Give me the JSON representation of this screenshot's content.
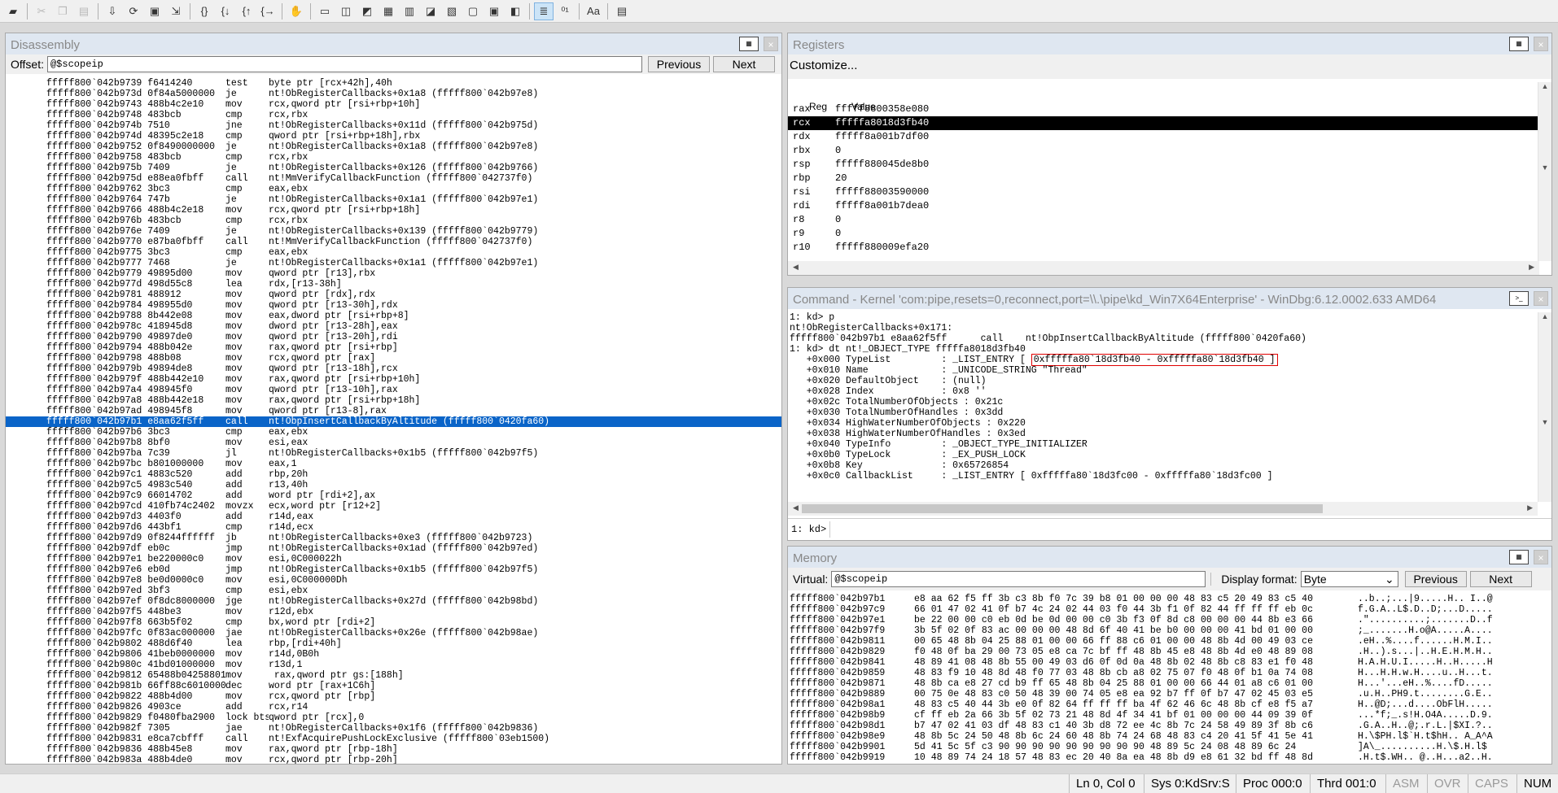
{
  "toolbar": {
    "icons": [
      "open-icon",
      "cut-icon",
      "copy-icon",
      "paste-icon",
      "step-into-icon",
      "step-over-icon",
      "step-out-icon",
      "run-to-cursor-icon",
      "go-icon",
      "break-icon",
      "restart-icon",
      "stop-icon",
      "source-mode-icon",
      "command-icon",
      "watch-icon",
      "locals-icon",
      "registers-icon",
      "memory-icon",
      "call-stack-icon",
      "disassembly-icon",
      "scratch-pad-icon",
      "processes-icon",
      "source-mode-toggle-icon",
      "hex-mode-icon",
      "font-icon",
      "options-icon"
    ]
  },
  "disassembly": {
    "title": "Disassembly",
    "offset_label": "Offset:",
    "offset_value": "@$scopeip",
    "previous_label": "Previous",
    "next_label": "Next",
    "lines": [
      {
        "addr": "fffff800`042b9739 f6414240",
        "mn": "test",
        "op": "byte ptr [rcx+42h],40h"
      },
      {
        "addr": "fffff800`042b973d 0f84a5000000",
        "mn": "je",
        "op": "nt!ObRegisterCallbacks+0x1a8 (fffff800`042b97e8)"
      },
      {
        "addr": "fffff800`042b9743 488b4c2e10",
        "mn": "mov",
        "op": "rcx,qword ptr [rsi+rbp+10h]"
      },
      {
        "addr": "fffff800`042b9748 483bcb",
        "mn": "cmp",
        "op": "rcx,rbx"
      },
      {
        "addr": "fffff800`042b974b 7510",
        "mn": "jne",
        "op": "nt!ObRegisterCallbacks+0x11d (fffff800`042b975d)"
      },
      {
        "addr": "fffff800`042b974d 48395c2e18",
        "mn": "cmp",
        "op": "qword ptr [rsi+rbp+18h],rbx"
      },
      {
        "addr": "fffff800`042b9752 0f8490000000",
        "mn": "je",
        "op": "nt!ObRegisterCallbacks+0x1a8 (fffff800`042b97e8)"
      },
      {
        "addr": "fffff800`042b9758 483bcb",
        "mn": "cmp",
        "op": "rcx,rbx"
      },
      {
        "addr": "fffff800`042b975b 7409",
        "mn": "je",
        "op": "nt!ObRegisterCallbacks+0x126 (fffff800`042b9766)"
      },
      {
        "addr": "fffff800`042b975d e88ea0fbff",
        "mn": "call",
        "op": "nt!MmVerifyCallbackFunction (fffff800`042737f0)"
      },
      {
        "addr": "fffff800`042b9762 3bc3",
        "mn": "cmp",
        "op": "eax,ebx"
      },
      {
        "addr": "fffff800`042b9764 747b",
        "mn": "je",
        "op": "nt!ObRegisterCallbacks+0x1a1 (fffff800`042b97e1)"
      },
      {
        "addr": "fffff800`042b9766 488b4c2e18",
        "mn": "mov",
        "op": "rcx,qword ptr [rsi+rbp+18h]"
      },
      {
        "addr": "fffff800`042b976b 483bcb",
        "mn": "cmp",
        "op": "rcx,rbx"
      },
      {
        "addr": "fffff800`042b976e 7409",
        "mn": "je",
        "op": "nt!ObRegisterCallbacks+0x139 (fffff800`042b9779)"
      },
      {
        "addr": "fffff800`042b9770 e87ba0fbff",
        "mn": "call",
        "op": "nt!MmVerifyCallbackFunction (fffff800`042737f0)"
      },
      {
        "addr": "fffff800`042b9775 3bc3",
        "mn": "cmp",
        "op": "eax,ebx"
      },
      {
        "addr": "fffff800`042b9777 7468",
        "mn": "je",
        "op": "nt!ObRegisterCallbacks+0x1a1 (fffff800`042b97e1)"
      },
      {
        "addr": "fffff800`042b9779 49895d00",
        "mn": "mov",
        "op": "qword ptr [r13],rbx"
      },
      {
        "addr": "fffff800`042b977d 498d55c8",
        "mn": "lea",
        "op": "rdx,[r13-38h]"
      },
      {
        "addr": "fffff800`042b9781 488912",
        "mn": "mov",
        "op": "qword ptr [rdx],rdx"
      },
      {
        "addr": "fffff800`042b9784 498955d0",
        "mn": "mov",
        "op": "qword ptr [r13-30h],rdx"
      },
      {
        "addr": "fffff800`042b9788 8b442e08",
        "mn": "mov",
        "op": "eax,dword ptr [rsi+rbp+8]"
      },
      {
        "addr": "fffff800`042b978c 418945d8",
        "mn": "mov",
        "op": "dword ptr [r13-28h],eax"
      },
      {
        "addr": "fffff800`042b9790 49897de0",
        "mn": "mov",
        "op": "qword ptr [r13-20h],rdi"
      },
      {
        "addr": "fffff800`042b9794 488b042e",
        "mn": "mov",
        "op": "rax,qword ptr [rsi+rbp]"
      },
      {
        "addr": "fffff800`042b9798 488b08",
        "mn": "mov",
        "op": "rcx,qword ptr [rax]"
      },
      {
        "addr": "fffff800`042b979b 49894de8",
        "mn": "mov",
        "op": "qword ptr [r13-18h],rcx"
      },
      {
        "addr": "fffff800`042b979f 488b442e10",
        "mn": "mov",
        "op": "rax,qword ptr [rsi+rbp+10h]"
      },
      {
        "addr": "fffff800`042b97a4 498945f0",
        "mn": "mov",
        "op": "qword ptr [r13-10h],rax"
      },
      {
        "addr": "fffff800`042b97a8 488b442e18",
        "mn": "mov",
        "op": "rax,qword ptr [rsi+rbp+18h]"
      },
      {
        "addr": "fffff800`042b97ad 498945f8",
        "mn": "mov",
        "op": "qword ptr [r13-8],rax"
      },
      {
        "addr": "fffff800`042b97b1 e8aa62f5ff",
        "mn": "call",
        "op": "nt!ObpInsertCallbackByAltitude (fffff800`0420fa60)"
      },
      {
        "addr": "fffff800`042b97b6 3bc3",
        "mn": "cmp",
        "op": "eax,ebx"
      },
      {
        "addr": "fffff800`042b97b8 8bf0",
        "mn": "mov",
        "op": "esi,eax"
      },
      {
        "addr": "fffff800`042b97ba 7c39",
        "mn": "jl",
        "op": "nt!ObRegisterCallbacks+0x1b5 (fffff800`042b97f5)"
      },
      {
        "addr": "fffff800`042b97bc b801000000",
        "mn": "mov",
        "op": "eax,1"
      },
      {
        "addr": "fffff800`042b97c1 4883c520",
        "mn": "add",
        "op": "rbp,20h"
      },
      {
        "addr": "fffff800`042b97c5 4983c540",
        "mn": "add",
        "op": "r13,40h"
      },
      {
        "addr": "fffff800`042b97c9 66014702",
        "mn": "add",
        "op": "word ptr [rdi+2],ax"
      },
      {
        "addr": "fffff800`042b97cd 410fb74c2402",
        "mn": "movzx",
        "op": "ecx,word ptr [r12+2]"
      },
      {
        "addr": "fffff800`042b97d3 4403f0",
        "mn": "add",
        "op": "r14d,eax"
      },
      {
        "addr": "fffff800`042b97d6 443bf1",
        "mn": "cmp",
        "op": "r14d,ecx"
      },
      {
        "addr": "fffff800`042b97d9 0f8244ffffff",
        "mn": "jb",
        "op": "nt!ObRegisterCallbacks+0xe3 (fffff800`042b9723)"
      },
      {
        "addr": "fffff800`042b97df eb0c",
        "mn": "jmp",
        "op": "nt!ObRegisterCallbacks+0x1ad (fffff800`042b97ed)"
      },
      {
        "addr": "fffff800`042b97e1 be220000c0",
        "mn": "mov",
        "op": "esi,0C000022h"
      },
      {
        "addr": "fffff800`042b97e6 eb0d",
        "mn": "jmp",
        "op": "nt!ObRegisterCallbacks+0x1b5 (fffff800`042b97f5)"
      },
      {
        "addr": "fffff800`042b97e8 be0d0000c0",
        "mn": "mov",
        "op": "esi,0C000000Dh"
      },
      {
        "addr": "fffff800`042b97ed 3bf3",
        "mn": "cmp",
        "op": "esi,ebx"
      },
      {
        "addr": "fffff800`042b97ef 0f8dc8000000",
        "mn": "jge",
        "op": "nt!ObRegisterCallbacks+0x27d (fffff800`042b98bd)"
      },
      {
        "addr": "fffff800`042b97f5 448be3",
        "mn": "mov",
        "op": "r12d,ebx"
      },
      {
        "addr": "fffff800`042b97f8 663b5f02",
        "mn": "cmp",
        "op": "bx,word ptr [rdi+2]"
      },
      {
        "addr": "fffff800`042b97fc 0f83ac000000",
        "mn": "jae",
        "op": "nt!ObRegisterCallbacks+0x26e (fffff800`042b98ae)"
      },
      {
        "addr": "fffff800`042b9802 488d6f40",
        "mn": "lea",
        "op": "rbp,[rdi+40h]"
      },
      {
        "addr": "fffff800`042b9806 41beb0000000",
        "mn": "mov",
        "op": "r14d,0B0h"
      },
      {
        "addr": "fffff800`042b980c 41bd01000000",
        "mn": "mov",
        "op": "r13d,1"
      },
      {
        "addr": "fffff800`042b9812 65488b042588010000",
        "mn": "mov",
        "op": " rax,qword ptr gs:[188h]"
      },
      {
        "addr": "fffff800`042b981b 66ff88c6010000",
        "mn": "dec",
        "op": "word ptr [rax+1C6h]"
      },
      {
        "addr": "fffff800`042b9822 488b4d00",
        "mn": "mov",
        "op": "rcx,qword ptr [rbp]"
      },
      {
        "addr": "fffff800`042b9826 4903ce",
        "mn": "add",
        "op": "rcx,r14"
      },
      {
        "addr": "fffff800`042b9829 f0480fba2900",
        "mn": "lock bts",
        "op": "qword ptr [rcx],0"
      },
      {
        "addr": "fffff800`042b982f 7305",
        "mn": "jae",
        "op": "nt!ObRegisterCallbacks+0x1f6 (fffff800`042b9836)"
      },
      {
        "addr": "fffff800`042b9831 e8ca7cbfff",
        "mn": "call",
        "op": "nt!ExfAcquirePushLockExclusive (fffff800`03eb1500)"
      },
      {
        "addr": "fffff800`042b9836 488b45e8",
        "mn": "mov",
        "op": "rax,qword ptr [rbp-18h]"
      },
      {
        "addr": "fffff800`042b983a 488b4de0",
        "mn": "mov",
        "op": "rcx,qword ptr [rbp-20h]"
      }
    ]
  },
  "registers": {
    "title": "Registers",
    "customize_label": "Customize...",
    "col_reg": "Reg",
    "col_value": "Value",
    "rows": [
      {
        "name": "rax",
        "value": "fffff8800358e080"
      },
      {
        "name": "rcx",
        "value": "fffffa8018d3fb40"
      },
      {
        "name": "rdx",
        "value": "fffff8a001b7df00"
      },
      {
        "name": "rbx",
        "value": "0"
      },
      {
        "name": "rsp",
        "value": "fffff880045de8b0"
      },
      {
        "name": "rbp",
        "value": "20"
      },
      {
        "name": "rsi",
        "value": "fffff88003590000"
      },
      {
        "name": "rdi",
        "value": "fffff8a001b7dea0"
      },
      {
        "name": "r8",
        "value": "0"
      },
      {
        "name": "r9",
        "value": "0"
      },
      {
        "name": "r10",
        "value": "fffff880009efa20"
      }
    ]
  },
  "command": {
    "title": "Command - Kernel 'com:pipe,resets=0,reconnect,port=\\\\.\\pipe\\kd_Win7X64Enterprise' - WinDbg:6.12.0002.633 AMD64",
    "lines": [
      "1: kd> p",
      "nt!ObRegisterCallbacks+0x171:",
      "fffff800`042b97b1 e8aa62f5ff      call    nt!ObpInsertCallbackByAltitude (fffff800`0420fa60)",
      "1: kd> dt nt!_OBJECT_TYPE fffffa8018d3fb40"
    ],
    "typelist_prefix": "   +0x000 TypeList         : _LIST_ENTRY [ ",
    "typelist_value": "0xfffffa80`18d3fb40 - 0xfffffa80`18d3fb40 ]",
    "lines2": [
      "   +0x010 Name             : _UNICODE_STRING \"Thread\"",
      "   +0x020 DefaultObject    : (null)",
      "   +0x028 Index            : 0x8 ''",
      "   +0x02c TotalNumberOfObjects : 0x21c",
      "   +0x030 TotalNumberOfHandles : 0x3dd",
      "   +0x034 HighWaterNumberOfObjects : 0x220",
      "   +0x038 HighWaterNumberOfHandles : 0x3ed",
      "   +0x040 TypeInfo         : _OBJECT_TYPE_INITIALIZER",
      "   +0x0b0 TypeLock         : _EX_PUSH_LOCK",
      "   +0x0b8 Key              : 0x65726854",
      "   +0x0c0 CallbackList     : _LIST_ENTRY [ 0xfffffa80`18d3fc00 - 0xfffffa80`18d3fc00 ]"
    ],
    "prompt": "1: kd>",
    "input_value": ""
  },
  "memory": {
    "title": "Memory",
    "virtual_label": "Virtual:",
    "virtual_value": "@$scopeip",
    "format_label": "Display format:",
    "format_value": "Byte",
    "previous_label": "Previous",
    "next_label": "Next",
    "rows": [
      {
        "addr": "fffff800`042b97b1",
        "hex": "e8 aa 62 f5 ff 3b c3 8b f0 7c 39 b8 01 00 00 00 48 83 c5 20 49 83 c5 40",
        "ascii": "..b..;...|9.....H.. I..@"
      },
      {
        "addr": "fffff800`042b97c9",
        "hex": "66 01 47 02 41 0f b7 4c 24 02 44 03 f0 44 3b f1 0f 82 44 ff ff ff eb 0c",
        "ascii": "f.G.A..L$.D..D;...D....."
      },
      {
        "addr": "fffff800`042b97e1",
        "hex": "be 22 00 00 c0 eb 0d be 0d 00 00 c0 3b f3 0f 8d c8 00 00 00 44 8b e3 66",
        "ascii": ".\"..........;.......D..f"
      },
      {
        "addr": "fffff800`042b97f9",
        "hex": "3b 5f 02 0f 83 ac 00 00 00 48 8d 6f 40 41 be b0 00 00 00 41 bd 01 00 00",
        "ascii": ";_.......H.o@A.....A...."
      },
      {
        "addr": "fffff800`042b9811",
        "hex": "00 65 48 8b 04 25 88 01 00 00 66 ff 88 c6 01 00 00 48 8b 4d 00 49 03 ce",
        "ascii": ".eH..%....f......H.M.I.."
      },
      {
        "addr": "fffff800`042b9829",
        "hex": "f0 48 0f ba 29 00 73 05 e8 ca 7c bf ff 48 8b 45 e8 48 8b 4d e0 48 89 08",
        "ascii": ".H..).s...|..H.E.H.M.H.."
      },
      {
        "addr": "fffff800`042b9841",
        "hex": "48 89 41 08 48 8b 55 00 49 03 d6 0f 0d 0a 48 8b 02 48 8b c8 83 e1 f0 48",
        "ascii": "H.A.H.U.I.....H..H.....H"
      },
      {
        "addr": "fffff800`042b9859",
        "hex": "48 83 f9 10 48 8d 48 f0 77 03 48 8b cb a8 02 75 07 f0 48 0f b1 0a 74 08",
        "ascii": "H...H.H.w.H....u..H...t."
      },
      {
        "addr": "fffff800`042b9871",
        "hex": "48 8b ca e8 27 cd b9 ff 65 48 8b 04 25 88 01 00 00 66 44 01 a8 c6 01 00",
        "ascii": "H...'...eH..%....fD....."
      },
      {
        "addr": "fffff800`042b9889",
        "hex": "00 75 0e 48 83 c0 50 48 39 00 74 05 e8 ea 92 b7 ff 0f b7 47 02 45 03 e5",
        "ascii": ".u.H..PH9.t........G.E.."
      },
      {
        "addr": "fffff800`042b98a1",
        "hex": "48 83 c5 40 44 3b e0 0f 82 64 ff ff ff ba 4f 62 46 6c 48 8b cf e8 f5 a7",
        "ascii": "H..@D;...d....ObFlH....."
      },
      {
        "addr": "fffff800`042b98b9",
        "hex": "cf ff eb 2a 66 3b 5f 02 73 21 48 8d 4f 34 41 bf 01 00 00 00 44 09 39 0f",
        "ascii": "...*f;_.s!H.O4A.....D.9."
      },
      {
        "addr": "fffff800`042b98d1",
        "hex": "b7 47 02 41 03 df 48 83 c1 40 3b d8 72 ee 4c 8b 7c 24 58 49 89 3f 8b c6",
        "ascii": ".G.A..H..@;.r.L.|$XI.?.."
      },
      {
        "addr": "fffff800`042b98e9",
        "hex": "48 8b 5c 24 50 48 8b 6c 24 60 48 8b 74 24 68 48 83 c4 20 41 5f 41 5e 41",
        "ascii": "H.\\$PH.l$`H.t$hH.. A_A^A"
      },
      {
        "addr": "fffff800`042b9901",
        "hex": "5d 41 5c 5f c3 90 90 90 90 90 90 90 90 90 48 89 5c 24 08 48 89 6c 24",
        "ascii": "]A\\_..........H.\\$.H.l$"
      },
      {
        "addr": "fffff800`042b9919",
        "hex": "10 48 89 74 24 18 57 48 83 ec 20 40 8a ea 48 8b d9 e8 61 32 bd ff 48 8d",
        "ascii": ".H.t$.WH.. @..H...a2..H."
      }
    ]
  },
  "status": {
    "ln_col": "Ln 0, Col 0",
    "sys": "Sys 0:KdSrv:S",
    "proc": "Proc 000:0",
    "thrd": "Thrd 001:0",
    "asm": "ASM",
    "ovr": "OVR",
    "caps": "CAPS",
    "num": "NUM"
  }
}
